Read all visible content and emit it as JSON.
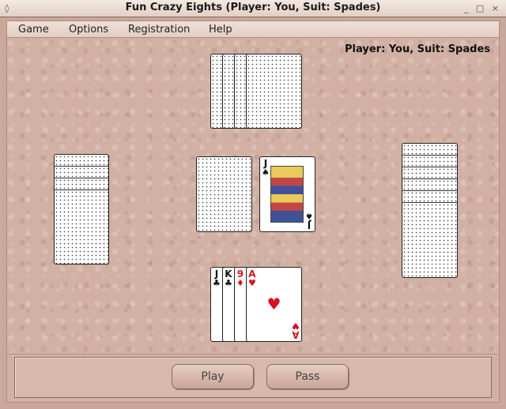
{
  "window": {
    "title": "Fun Crazy Eights (Player: You, Suit: Spades)",
    "left_glyph": "◊",
    "right_glyph": "_ □ ×"
  },
  "menu": [
    {
      "label": "Game"
    },
    {
      "label": "Options"
    },
    {
      "label": "Registration"
    },
    {
      "label": "Help"
    }
  ],
  "status": "Player: You, Suit: Spades",
  "discard_top": {
    "rank": "J",
    "suit": "♠",
    "color": "#111111"
  },
  "hand": [
    {
      "rank": "J",
      "suit": "♣",
      "color": "#111111"
    },
    {
      "rank": "K",
      "suit": "♣",
      "color": "#111111"
    },
    {
      "rank": "9",
      "suit": "♦",
      "color": "#d4141e"
    },
    {
      "rank": "A",
      "suit": "♥",
      "color": "#d4141e"
    }
  ],
  "buttons": {
    "play": "Play",
    "pass": "Pass"
  }
}
